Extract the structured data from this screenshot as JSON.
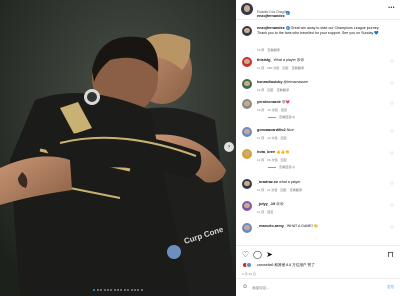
{
  "post": {
    "username": "enzojfernandez",
    "subtitle": "Estadio Dos Dragões",
    "caption": {
      "username": "enzojfernandez",
      "text": "Great win away to start our Champions League journey. Thank you to the fans who travelled for your support. See you on Sunday 💙",
      "time": "13 周",
      "action": "查看翻译"
    }
  },
  "comments": [
    {
      "username": "thisisfg_",
      "text": "What a player 😍😍",
      "time": "11 周",
      "likes": "260 次赞",
      "reply": "回复",
      "translate": "查看翻译",
      "avatar_color": "#c4312b"
    },
    {
      "username": "konradlosicky",
      "text": "@fernamassee",
      "time": "12 周",
      "likes": "",
      "reply": "回复",
      "translate": "查看翻译",
      "avatar_color": "#3f6a48"
    },
    {
      "username": "yeroleonarde",
      "text": "😍💗",
      "time": "13 周",
      "likes": "16 次赞",
      "reply": "回复",
      "translate": "",
      "replies": "查看回复(2)",
      "avatar_color": "#8a8a8a"
    },
    {
      "username": "gonzaacardillo2",
      "text": "Nice",
      "time": "11 周",
      "likes": "12 次赞",
      "reply": "回复",
      "translate": "",
      "avatar_color": "#6c88c7"
    },
    {
      "username": "hota_bree",
      "text": "👍👍👏",
      "time": "11 周",
      "likes": "16 次赞",
      "reply": "回复",
      "translate": "",
      "replies": "查看回复(1)",
      "avatar_color": "#d6a22c"
    },
    {
      "username": "_bradraz.ee",
      "text": "what a player",
      "time": "11 周",
      "likes": "11 次赞",
      "reply": "回复",
      "translate": "查看翻译",
      "avatar_color": "#30384a"
    },
    {
      "username": "_julyy_.19",
      "text": "😍😍",
      "time": "11 周",
      "likes": "",
      "reply": "回复",
      "translate": "",
      "avatar_color": "#7b5ba7"
    },
    {
      "username": "_marcelo.army_",
      "text": "WHAT A GAME! 👏",
      "time": "",
      "likes": "",
      "reply": "",
      "translate": "",
      "avatar_color": "#6c88c7"
    }
  ],
  "actions": {
    "like_icon": "heart-outline-icon",
    "comment_icon": "comment-icon",
    "share_icon": "paper-plane-icon",
    "save_icon": "bookmark-icon",
    "likes_text": "carusella6 和其他 8.8 万位用户 赞了",
    "date": "9 月 20 日",
    "comment_placeholder": "添加评论...",
    "post_label": "发布",
    "emoji_icon": "smiley-icon"
  },
  "photo": {
    "sponsor_text": "Curp Cone",
    "badge_text": "CITY",
    "next_arrow": "›",
    "prev_arrow": "‹"
  },
  "colors": {
    "accent": "#3897f0",
    "jersey": "#1b1c1a",
    "jersey_trim": "#c9b173",
    "background": "#2c312b"
  }
}
